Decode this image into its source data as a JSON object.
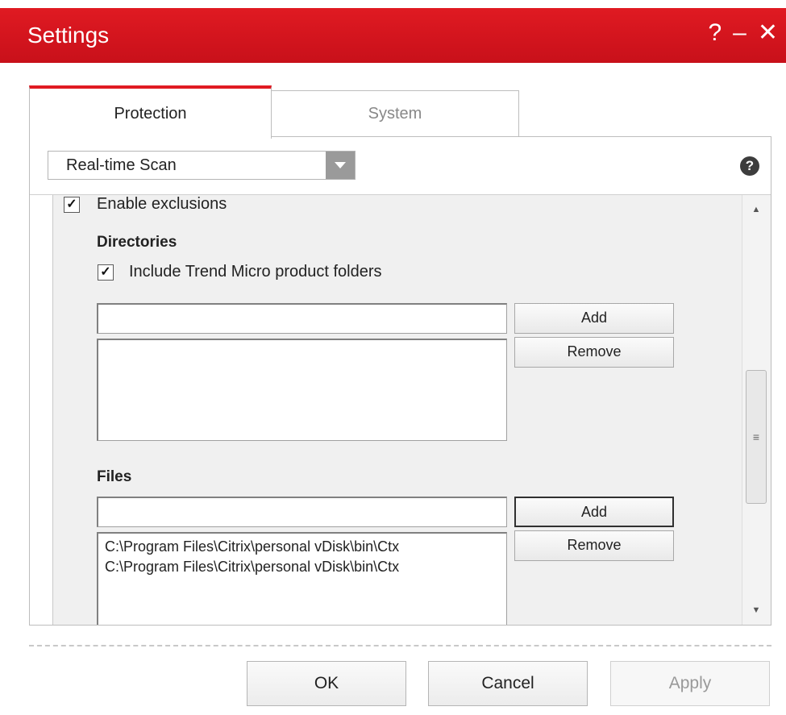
{
  "window": {
    "title": "Settings",
    "controls": {
      "help": "?",
      "minimize": "–",
      "close": "✕"
    }
  },
  "tabs": [
    {
      "label": "Protection",
      "active": true
    },
    {
      "label": "System",
      "active": false
    }
  ],
  "toolbar": {
    "dropdown_value": "Real-time Scan",
    "help_icon": "?"
  },
  "exclusions": {
    "enable_label": "Enable exclusions",
    "enable_checked": true,
    "directories": {
      "heading": "Directories",
      "include_label": "Include Trend Micro product folders",
      "include_checked": true,
      "input_value": "",
      "add_label": "Add",
      "remove_label": "Remove",
      "items": []
    },
    "files": {
      "heading": "Files",
      "input_value": "",
      "add_label": "Add",
      "remove_label": "Remove",
      "items": [
        "C:\\Program Files\\Citrix\\personal vDisk\\bin\\Ctx",
        "C:\\Program Files\\Citrix\\personal vDisk\\bin\\Ctx"
      ]
    }
  },
  "footer": {
    "ok_label": "OK",
    "cancel_label": "Cancel",
    "apply_label": "Apply"
  },
  "colors": {
    "title_bar": "#d3121b",
    "active_tab_accent": "#e01a22"
  }
}
